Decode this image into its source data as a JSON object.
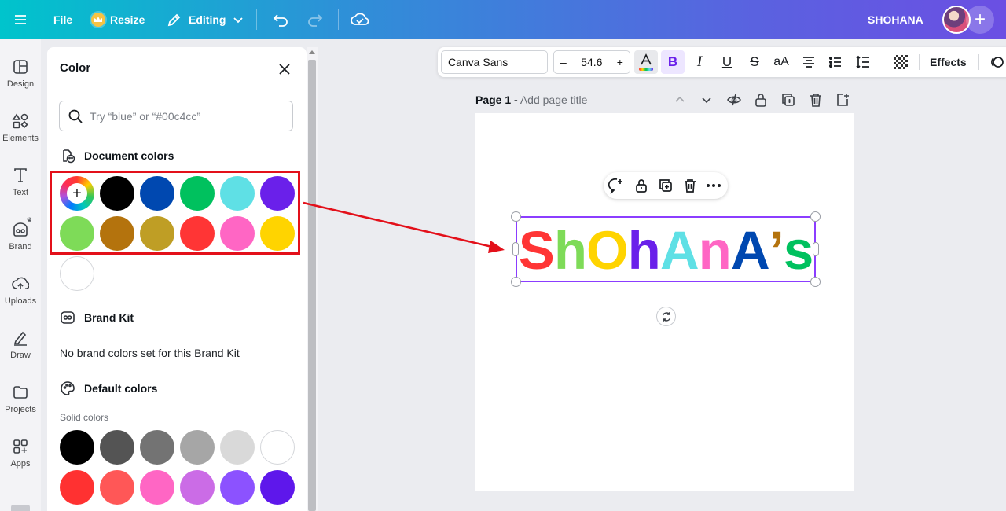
{
  "topbar": {
    "file_label": "File",
    "resize_label": "Resize",
    "editing_label": "Editing",
    "user_name": "SHOHANA",
    "plus_label": "+"
  },
  "sidebar": {
    "items": [
      {
        "label": "Design",
        "icon": "design-icon"
      },
      {
        "label": "Elements",
        "icon": "elements-icon"
      },
      {
        "label": "Text",
        "icon": "text-icon"
      },
      {
        "label": "Brand",
        "icon": "brand-icon"
      },
      {
        "label": "Uploads",
        "icon": "uploads-icon"
      },
      {
        "label": "Draw",
        "icon": "draw-icon"
      },
      {
        "label": "Projects",
        "icon": "projects-icon"
      },
      {
        "label": "Apps",
        "icon": "apps-icon"
      }
    ]
  },
  "color_panel": {
    "title": "Color",
    "search_placeholder": "Try “blue” or “#00c4cc”",
    "document_colors_title": "Document colors",
    "document_colors": [
      "#000000",
      "#0048b0",
      "#00c15e",
      "#5fe0e5",
      "#6a20ea",
      "#7edb58",
      "#b4730d",
      "#bf9e25",
      "#ff3535",
      "#ff66c4",
      "#ffd400",
      "#ffffff"
    ],
    "brand_kit_title": "Brand Kit",
    "brand_kit_empty": "No brand colors set for this Brand Kit",
    "default_colors_title": "Default colors",
    "solid_colors_label": "Solid colors",
    "solid_colors": [
      "#000000",
      "#545454",
      "#737373",
      "#a6a6a6",
      "#d9d9d9",
      "#ffffff",
      "#ff3131",
      "#ff5757",
      "#ff66c4",
      "#cb6ce6",
      "#8c52ff",
      "#5e17eb"
    ]
  },
  "text_toolbar": {
    "font_name": "Canva Sans",
    "font_size": "54.6",
    "decrease_label": "–",
    "increase_label": "+",
    "bold_label": "B",
    "italic_label": "I",
    "underline_label": "U",
    "strike_label": "S",
    "case_label": "aA",
    "effects_label": "Effects"
  },
  "page": {
    "label": "Page 1 -",
    "title_placeholder": "Add page title"
  },
  "canvas_text": {
    "letters": [
      {
        "char": "S",
        "color": "#ff3535"
      },
      {
        "char": "h",
        "color": "#7edb58"
      },
      {
        "char": "O",
        "color": "#ffd400"
      },
      {
        "char": "h",
        "color": "#6a20ea"
      },
      {
        "char": "A",
        "color": "#5fe0e5"
      },
      {
        "char": "n",
        "color": "#ff66c4"
      },
      {
        "char": "A",
        "color": "#0048b0"
      },
      {
        "char": "’",
        "color": "#b4730d"
      },
      {
        "char": "s",
        "color": "#00c15e"
      }
    ]
  }
}
